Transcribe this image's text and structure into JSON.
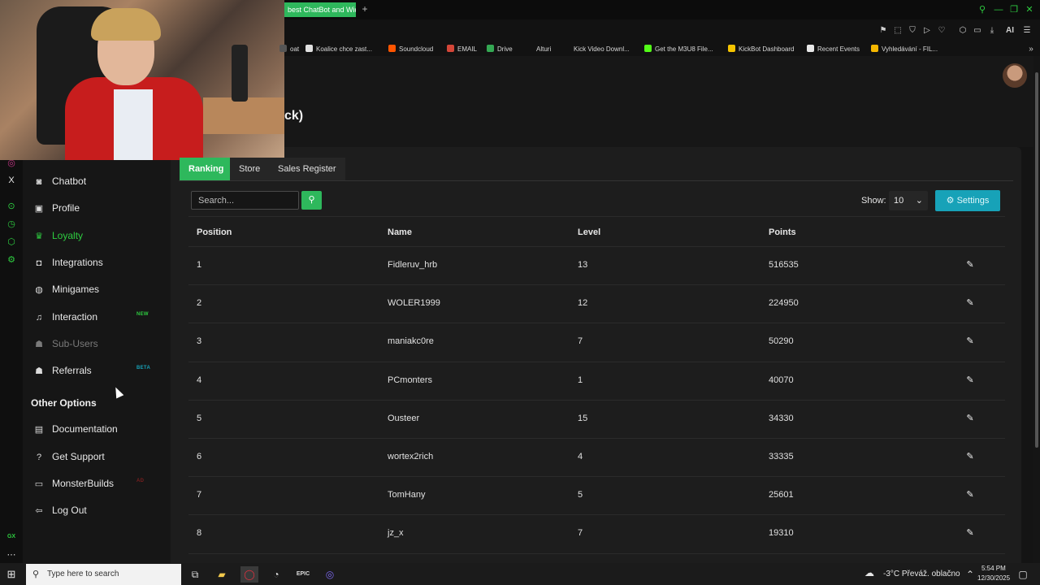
{
  "browser": {
    "active_tab": "best ChatBot and Wid",
    "new_tab_symbol": "+",
    "bookmarks": [
      {
        "label": "oat",
        "color": "#555555"
      },
      {
        "label": "Koalice chce zast...",
        "color": "#e0e0e0"
      },
      {
        "label": "Soundcloud",
        "color": "#ff5500"
      },
      {
        "label": "EMAIL",
        "color": "#d44638"
      },
      {
        "label": "Drive",
        "color": "#34a853"
      },
      {
        "label": "Alturi",
        "color": "#121212"
      },
      {
        "label": "Kick Video Downl...",
        "color": "#121212"
      },
      {
        "label": "Get the M3U8 File...",
        "color": "#53fc18"
      },
      {
        "label": "KickBot Dashboard",
        "color": "#f5c400"
      },
      {
        "label": "Recent Events",
        "color": "#e8e8e8"
      },
      {
        "label": "Vyhledávání - FIL...",
        "color": "#f5b700"
      }
    ],
    "ai_label": "AI"
  },
  "page": {
    "title_fragment": "ck)"
  },
  "sidebar": {
    "items": [
      {
        "label": "Chatbot",
        "icon": "robot-icon",
        "glyph": "◙",
        "badge": ""
      },
      {
        "label": "Profile",
        "icon": "id-card-icon",
        "glyph": "▣",
        "badge": ""
      },
      {
        "label": "Loyalty",
        "icon": "trophy-icon",
        "glyph": "♛",
        "badge": "",
        "active": true
      },
      {
        "label": "Integrations",
        "icon": "plug-icon",
        "glyph": "◘",
        "badge": ""
      },
      {
        "label": "Minigames",
        "icon": "gamepad-icon",
        "glyph": "◍",
        "badge": ""
      },
      {
        "label": "Interaction",
        "icon": "music-icon",
        "glyph": "♫",
        "badge": "NEW",
        "badge_color": "#2ecc40"
      },
      {
        "label": "Sub-Users",
        "icon": "users-icon",
        "glyph": "☗",
        "badge": "",
        "muted": true
      },
      {
        "label": "Referrals",
        "icon": "user-group-icon",
        "glyph": "☗",
        "badge": "BETA",
        "badge_color": "#17a2b8"
      }
    ],
    "other_title": "Other Options",
    "other_items": [
      {
        "label": "Documentation",
        "icon": "book-icon",
        "glyph": "▤",
        "badge": ""
      },
      {
        "label": "Get Support",
        "icon": "question-icon",
        "glyph": "?",
        "badge": ""
      },
      {
        "label": "MonsterBuilds",
        "icon": "laptop-icon",
        "glyph": "▭",
        "badge": "AD",
        "badge_color": "#7a1f1f"
      },
      {
        "label": "Log Out",
        "icon": "logout-icon",
        "glyph": "⇦",
        "badge": ""
      }
    ]
  },
  "tabs": [
    {
      "label": "Ranking",
      "active": true
    },
    {
      "label": "Store",
      "active": false
    },
    {
      "label": "Sales Register",
      "active": false
    }
  ],
  "controls": {
    "search_placeholder": "Search...",
    "show_label": "Show:",
    "show_value": "10",
    "settings_label": "Settings"
  },
  "table": {
    "headers": [
      "Position",
      "Name",
      "Level",
      "Points"
    ],
    "rows": [
      {
        "position": "1",
        "name": "Fidleruv_hrb",
        "level": "13",
        "points": "516535"
      },
      {
        "position": "2",
        "name": "WOLER1999",
        "level": "12",
        "points": "224950"
      },
      {
        "position": "3",
        "name": "maniakc0re",
        "level": "7",
        "points": "50290"
      },
      {
        "position": "4",
        "name": "PCmonters",
        "level": "1",
        "points": "40070"
      },
      {
        "position": "5",
        "name": "Ousteer",
        "level": "15",
        "points": "34330"
      },
      {
        "position": "6",
        "name": "wortex2rich",
        "level": "4",
        "points": "33335"
      },
      {
        "position": "7",
        "name": "TomHany",
        "level": "5",
        "points": "25601"
      },
      {
        "position": "8",
        "name": "jz_x",
        "level": "7",
        "points": "19310"
      }
    ]
  },
  "taskbar": {
    "search_placeholder": "Type here to search",
    "weather": "-3°C  Převáž. oblačno",
    "time": "5:54 PM",
    "date": "12/30/2025"
  },
  "colors": {
    "accent": "#2eb85c",
    "settings": "#17a2b8",
    "background": "#141414"
  }
}
